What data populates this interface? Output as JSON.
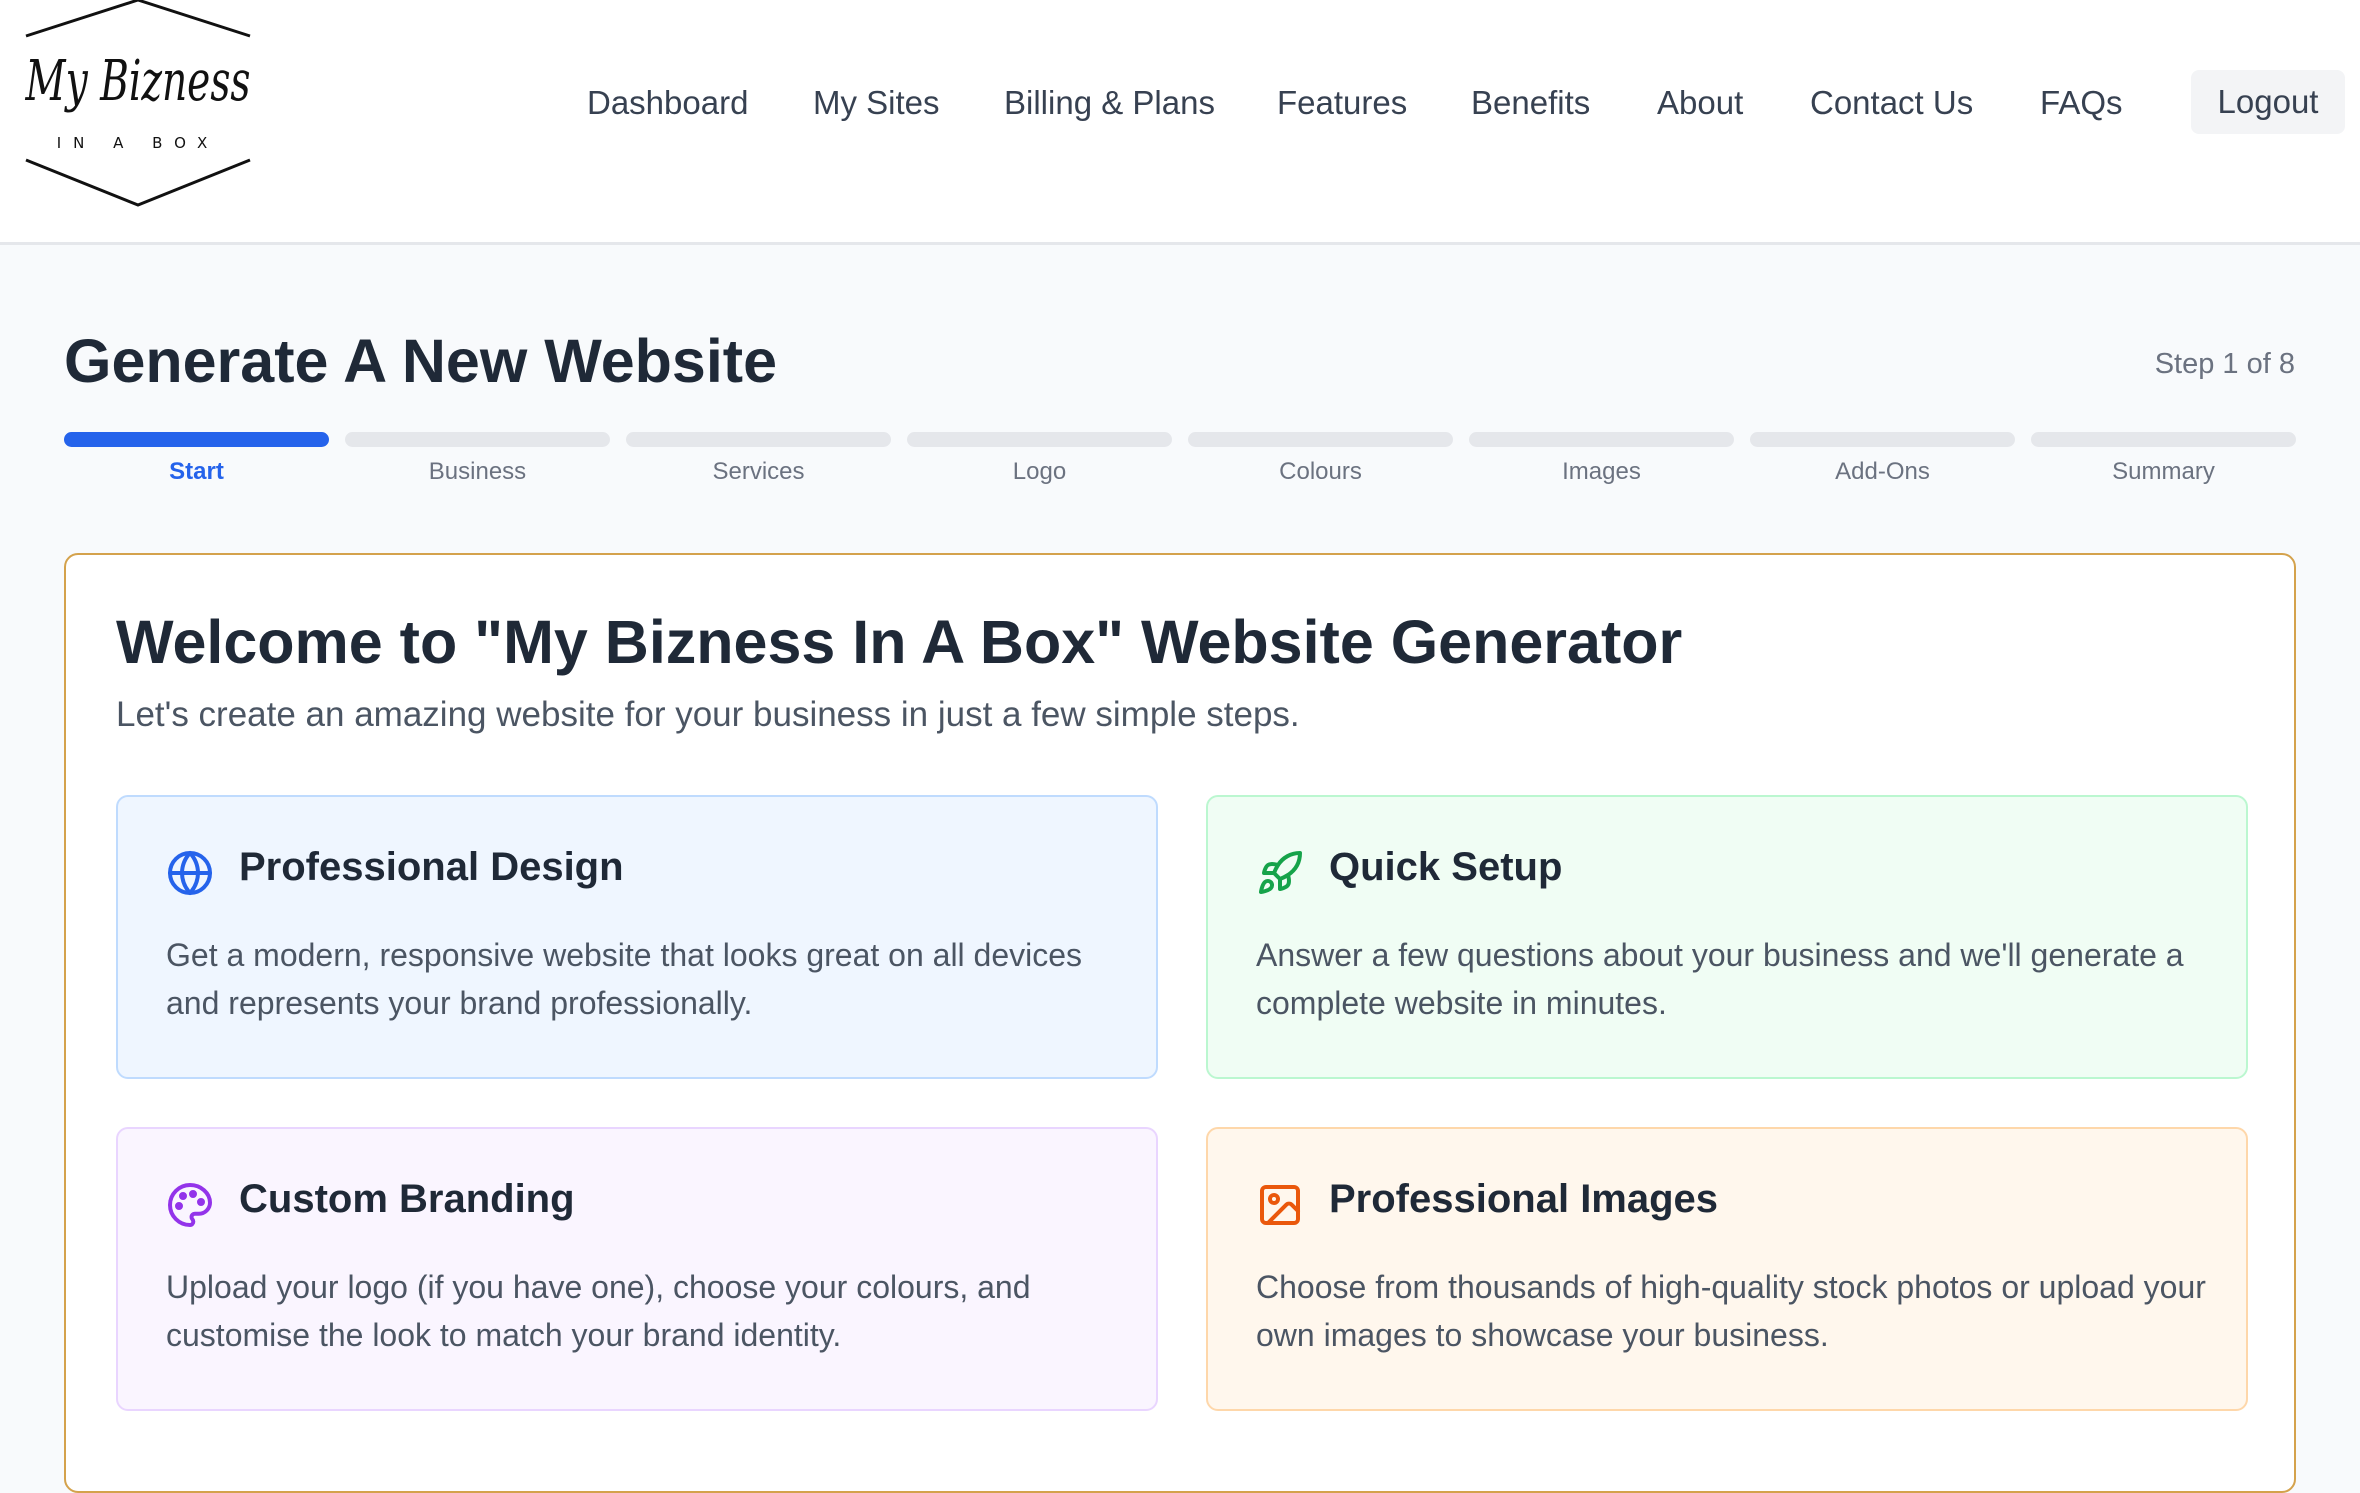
{
  "brand": {
    "name": "My Bizness",
    "tagline": "IN A BOX"
  },
  "nav": {
    "items": [
      {
        "label": "Dashboard"
      },
      {
        "label": "My Sites"
      },
      {
        "label": "Billing & Plans"
      },
      {
        "label": "Features"
      },
      {
        "label": "Benefits"
      },
      {
        "label": "About"
      },
      {
        "label": "Contact Us"
      },
      {
        "label": "FAQs"
      }
    ],
    "logout_label": "Logout"
  },
  "page": {
    "title": "Generate A New Website",
    "step_indicator": "Step 1 of 8"
  },
  "steps": [
    {
      "label": "Start",
      "active": true
    },
    {
      "label": "Business",
      "active": false
    },
    {
      "label": "Services",
      "active": false
    },
    {
      "label": "Logo",
      "active": false
    },
    {
      "label": "Colours",
      "active": false
    },
    {
      "label": "Images",
      "active": false
    },
    {
      "label": "Add-Ons",
      "active": false
    },
    {
      "label": "Summary",
      "active": false
    }
  ],
  "welcome": {
    "title": "Welcome to \"My Bizness In A Box\" Website Generator",
    "subtitle": "Let's create an amazing website for your business in just a few simple steps."
  },
  "features": [
    {
      "icon": "globe-icon",
      "color": "#2563eb",
      "title": "Professional Design",
      "description": "Get a modern, responsive website that looks great on all devices and represents your brand professionally."
    },
    {
      "icon": "rocket-icon",
      "color": "#16a34a",
      "title": "Quick Setup",
      "description": "Answer a few questions about your business and we'll generate a complete website in minutes."
    },
    {
      "icon": "palette-icon",
      "color": "#9333ea",
      "title": "Custom Branding",
      "description": "Upload your logo (if you have one), choose your colours, and customise the look to match your brand identity."
    },
    {
      "icon": "image-icon",
      "color": "#ea580c",
      "title": "Professional Images",
      "description": "Choose from thousands of high-quality stock photos or upload your own images to showcase your business."
    }
  ],
  "colors": {
    "accent": "#2563eb",
    "card_border": "#d4a24c"
  }
}
